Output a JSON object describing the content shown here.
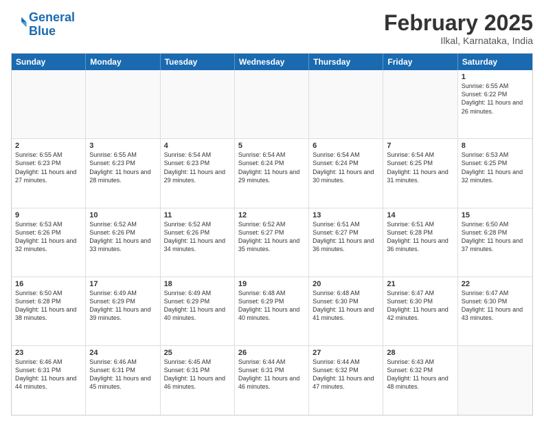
{
  "logo": {
    "line1": "General",
    "line2": "Blue"
  },
  "title": "February 2025",
  "subtitle": "Ilkal, Karnataka, India",
  "weekdays": [
    "Sunday",
    "Monday",
    "Tuesday",
    "Wednesday",
    "Thursday",
    "Friday",
    "Saturday"
  ],
  "weeks": [
    [
      {
        "day": "",
        "info": ""
      },
      {
        "day": "",
        "info": ""
      },
      {
        "day": "",
        "info": ""
      },
      {
        "day": "",
        "info": ""
      },
      {
        "day": "",
        "info": ""
      },
      {
        "day": "",
        "info": ""
      },
      {
        "day": "1",
        "info": "Sunrise: 6:55 AM\nSunset: 6:22 PM\nDaylight: 11 hours and 26 minutes."
      }
    ],
    [
      {
        "day": "2",
        "info": "Sunrise: 6:55 AM\nSunset: 6:23 PM\nDaylight: 11 hours and 27 minutes."
      },
      {
        "day": "3",
        "info": "Sunrise: 6:55 AM\nSunset: 6:23 PM\nDaylight: 11 hours and 28 minutes."
      },
      {
        "day": "4",
        "info": "Sunrise: 6:54 AM\nSunset: 6:23 PM\nDaylight: 11 hours and 29 minutes."
      },
      {
        "day": "5",
        "info": "Sunrise: 6:54 AM\nSunset: 6:24 PM\nDaylight: 11 hours and 29 minutes."
      },
      {
        "day": "6",
        "info": "Sunrise: 6:54 AM\nSunset: 6:24 PM\nDaylight: 11 hours and 30 minutes."
      },
      {
        "day": "7",
        "info": "Sunrise: 6:54 AM\nSunset: 6:25 PM\nDaylight: 11 hours and 31 minutes."
      },
      {
        "day": "8",
        "info": "Sunrise: 6:53 AM\nSunset: 6:25 PM\nDaylight: 11 hours and 32 minutes."
      }
    ],
    [
      {
        "day": "9",
        "info": "Sunrise: 6:53 AM\nSunset: 6:26 PM\nDaylight: 11 hours and 32 minutes."
      },
      {
        "day": "10",
        "info": "Sunrise: 6:52 AM\nSunset: 6:26 PM\nDaylight: 11 hours and 33 minutes."
      },
      {
        "day": "11",
        "info": "Sunrise: 6:52 AM\nSunset: 6:26 PM\nDaylight: 11 hours and 34 minutes."
      },
      {
        "day": "12",
        "info": "Sunrise: 6:52 AM\nSunset: 6:27 PM\nDaylight: 11 hours and 35 minutes."
      },
      {
        "day": "13",
        "info": "Sunrise: 6:51 AM\nSunset: 6:27 PM\nDaylight: 11 hours and 36 minutes."
      },
      {
        "day": "14",
        "info": "Sunrise: 6:51 AM\nSunset: 6:28 PM\nDaylight: 11 hours and 36 minutes."
      },
      {
        "day": "15",
        "info": "Sunrise: 6:50 AM\nSunset: 6:28 PM\nDaylight: 11 hours and 37 minutes."
      }
    ],
    [
      {
        "day": "16",
        "info": "Sunrise: 6:50 AM\nSunset: 6:28 PM\nDaylight: 11 hours and 38 minutes."
      },
      {
        "day": "17",
        "info": "Sunrise: 6:49 AM\nSunset: 6:29 PM\nDaylight: 11 hours and 39 minutes."
      },
      {
        "day": "18",
        "info": "Sunrise: 6:49 AM\nSunset: 6:29 PM\nDaylight: 11 hours and 40 minutes."
      },
      {
        "day": "19",
        "info": "Sunrise: 6:48 AM\nSunset: 6:29 PM\nDaylight: 11 hours and 40 minutes."
      },
      {
        "day": "20",
        "info": "Sunrise: 6:48 AM\nSunset: 6:30 PM\nDaylight: 11 hours and 41 minutes."
      },
      {
        "day": "21",
        "info": "Sunrise: 6:47 AM\nSunset: 6:30 PM\nDaylight: 11 hours and 42 minutes."
      },
      {
        "day": "22",
        "info": "Sunrise: 6:47 AM\nSunset: 6:30 PM\nDaylight: 11 hours and 43 minutes."
      }
    ],
    [
      {
        "day": "23",
        "info": "Sunrise: 6:46 AM\nSunset: 6:31 PM\nDaylight: 11 hours and 44 minutes."
      },
      {
        "day": "24",
        "info": "Sunrise: 6:46 AM\nSunset: 6:31 PM\nDaylight: 11 hours and 45 minutes."
      },
      {
        "day": "25",
        "info": "Sunrise: 6:45 AM\nSunset: 6:31 PM\nDaylight: 11 hours and 46 minutes."
      },
      {
        "day": "26",
        "info": "Sunrise: 6:44 AM\nSunset: 6:31 PM\nDaylight: 11 hours and 46 minutes."
      },
      {
        "day": "27",
        "info": "Sunrise: 6:44 AM\nSunset: 6:32 PM\nDaylight: 11 hours and 47 minutes."
      },
      {
        "day": "28",
        "info": "Sunrise: 6:43 AM\nSunset: 6:32 PM\nDaylight: 11 hours and 48 minutes."
      },
      {
        "day": "",
        "info": ""
      }
    ]
  ]
}
